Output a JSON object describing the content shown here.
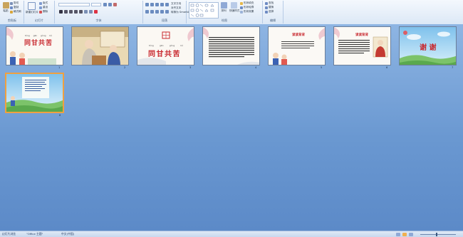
{
  "ribbon": {
    "groups": [
      {
        "id": "clipboard",
        "label": "剪贴板"
      },
      {
        "id": "slides",
        "label": "幻灯片"
      },
      {
        "id": "font",
        "label": "字体"
      },
      {
        "id": "paragraph",
        "label": "段落"
      },
      {
        "id": "drawing",
        "label": "绘图"
      },
      {
        "id": "editing",
        "label": "编辑"
      }
    ],
    "clipboard": {
      "paste": "粘贴",
      "cut": "剪切",
      "copy": "复制",
      "format_painter": "格式刷"
    },
    "slides": {
      "new_slide": "新建幻灯片",
      "layout": "版式",
      "reset": "重设",
      "delete": "删除"
    },
    "paragraph": {
      "text_direction": "文字方向",
      "align_text": "对齐文本",
      "smartart": "转换为 SmartArt"
    },
    "drawing": {
      "arrange": "排列",
      "quick_styles": "快速样式",
      "shape_fill": "形状填充",
      "shape_outline": "形状轮廓",
      "shape_effects": "形状效果"
    },
    "editing": {
      "find": "查找",
      "replace": "替换",
      "select": "选择"
    }
  },
  "slides": [
    {
      "number": "1",
      "pinyin": [
        "tóng",
        "gān",
        "gòng",
        "kǔ"
      ],
      "title": "同甘共苦"
    },
    {
      "number": "2"
    },
    {
      "number": "3",
      "pinyin": [
        "tóng",
        "gān",
        "gòng",
        "kǔ"
      ],
      "title": "同甘共苦"
    },
    {
      "number": "4"
    },
    {
      "number": "5",
      "heading": "读读背背"
    },
    {
      "number": "6",
      "heading": "读读背背"
    },
    {
      "number": "7",
      "title": "谢 谢"
    },
    {
      "number": "8"
    }
  ],
  "status": {
    "view": "幻灯片浏览",
    "theme": "\"Office 主题\"",
    "language": "中文(中国)"
  },
  "colors": {
    "accent_title": "#c8282e",
    "ribbon_bg": "#dce8f6",
    "slide_area": "#6f9ed6",
    "selection": "#f0a040"
  }
}
